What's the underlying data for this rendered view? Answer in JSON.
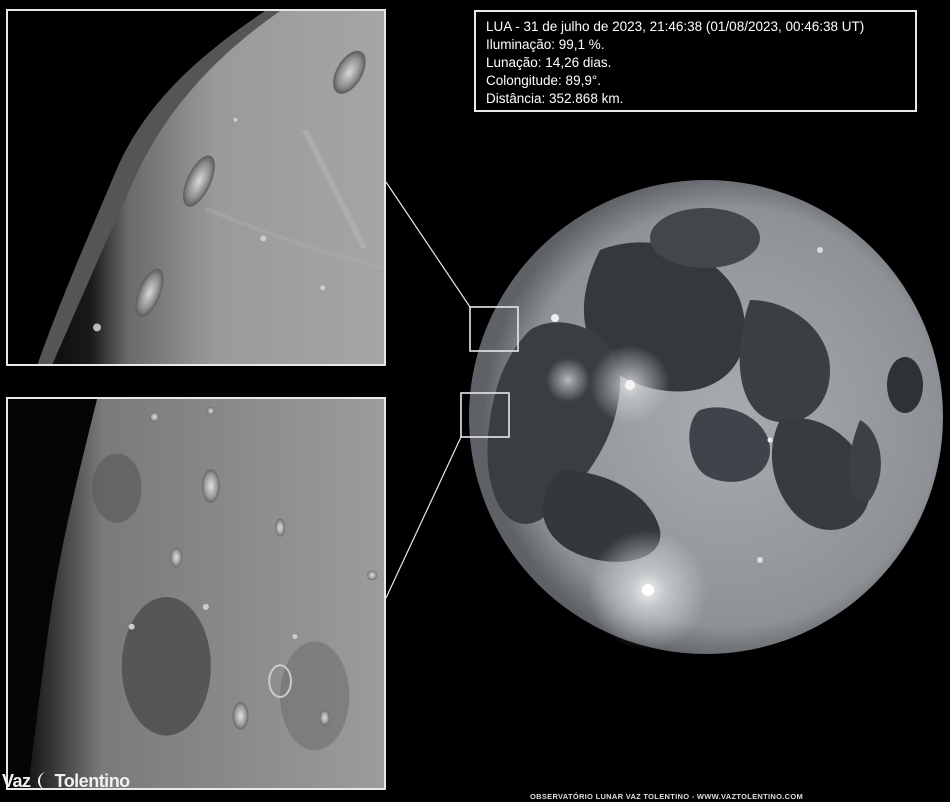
{
  "info": {
    "line1": "LUA - 31 de julho de 2023, 21:46:38 (01/08/2023, 00:46:38 UT)",
    "line2": "Iluminação: 99,1 %.",
    "line3": "Lunação: 14,26 dias.",
    "line4": "Colongitude: 89,9°.",
    "line5": "Distância: 352.868 km."
  },
  "logo": {
    "part1": "Vaz",
    "part2": "Tolentino"
  },
  "footer": {
    "text": "OBSERVATÓRIO LUNAR VAZ TOLENTINO  -  WWW.VAZTOLENTINO.COM"
  },
  "colors": {
    "background": "#000000",
    "frame": "#e8e8e8",
    "lunar_highlands": "#b5b8bb",
    "lunar_maria": "#3a3d42"
  }
}
